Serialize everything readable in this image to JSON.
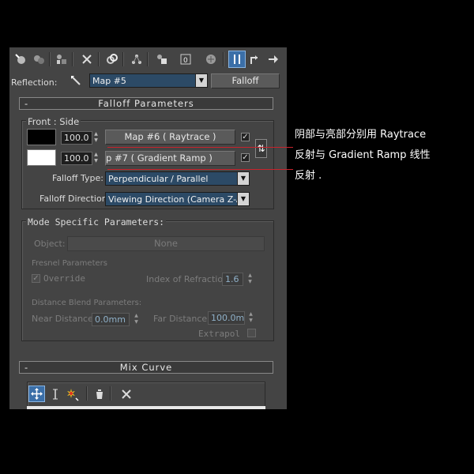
{
  "toolbar": {
    "icons": [
      "sample-slots-icon",
      "put-to-scene-icon",
      "assign-material-icon",
      "delete-icon",
      "make-unique-icon",
      "put-to-library-icon",
      "material-effects-icon",
      "show-map-icon",
      "show-end-result-icon",
      "go-to-parent-icon",
      "go-forward-icon"
    ]
  },
  "reflection": {
    "label": "Reflection:",
    "map_value": "Map #5",
    "type_button": "Falloff"
  },
  "falloff_params": {
    "title": "Falloff Parameters",
    "front_side_label": "Front : Side",
    "row1": {
      "swatch_color": "#000000",
      "amount": "100.0",
      "map_button": "Map #6  ( Raytrace )",
      "checked": true
    },
    "row2": {
      "swatch_color": "#ffffff",
      "amount": "100.0",
      "map_button": "p #7  ( Gradient Ramp )",
      "checked": true
    },
    "falloff_type_label": "Falloff Type:",
    "falloff_type_value": "Perpendicular / Parallel",
    "falloff_direction_label": "Falloff Direction:",
    "falloff_direction_value": "Viewing Direction (Camera Z-Axis)"
  },
  "mode_specific": {
    "title": "Mode Specific Parameters:",
    "object_label": "Object:",
    "object_button": "None",
    "fresnel_label": "Fresnel Parameters",
    "override_label": "Override",
    "override_checked": true,
    "ior_label": "Index of Refraction",
    "ior_value": "1.6",
    "distance_blend_label": "Distance Blend Parameters:",
    "near_label": "Near Distance:",
    "near_value": "0.0mm",
    "far_label": "Far Distance:",
    "far_value": "100.0m",
    "extrapolate_label": "Extrapol"
  },
  "mix_curve": {
    "title": "Mix Curve",
    "tools": [
      "move-icon",
      "scale-point-icon",
      "add-point-icon",
      "reset-curve-icon",
      "delete-point-icon"
    ]
  },
  "annotation": {
    "line1": "阴部与亮部分别用 Raytrace",
    "line2": "反射与 Gradient Ramp 线性",
    "line3": "反射 ."
  },
  "colors": {
    "panel": "#444444",
    "combo_blue": "#2c4a66",
    "selected_tool": "#3b6fa8",
    "annotation_underline": "#c8232c"
  }
}
